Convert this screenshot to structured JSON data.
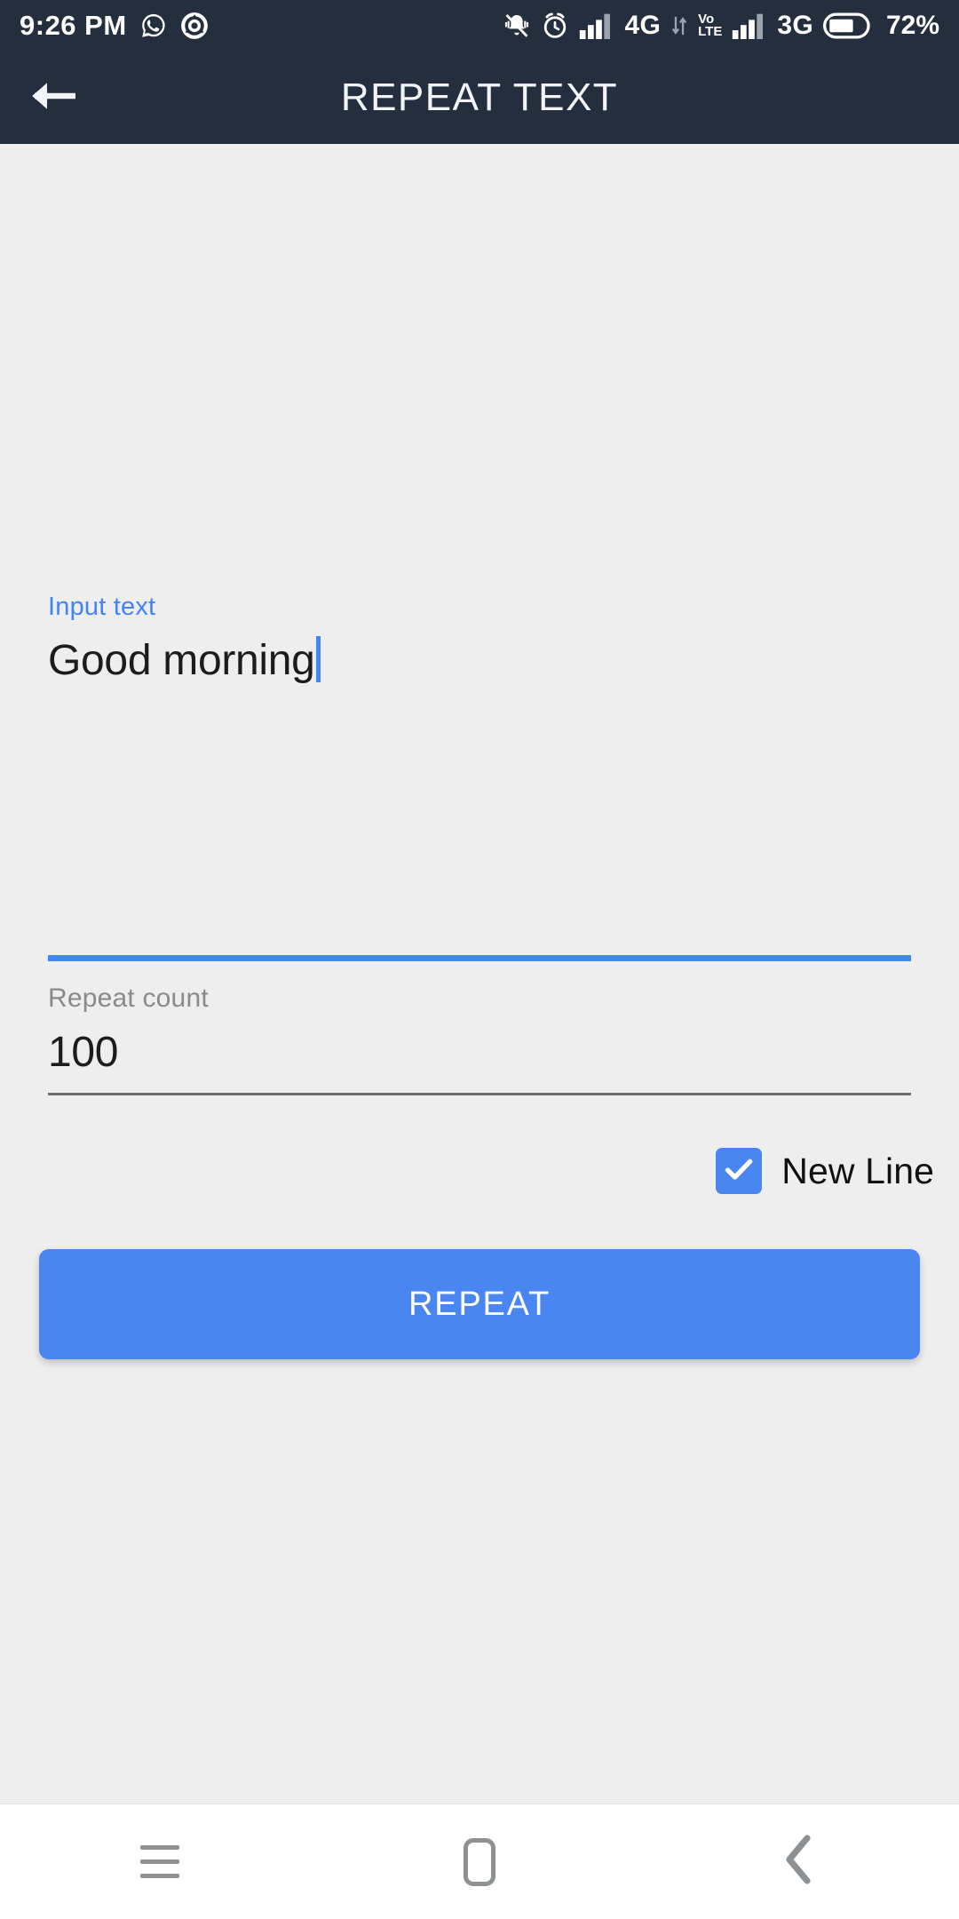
{
  "status_bar": {
    "clock": "9:26 PM",
    "left_icons": [
      "whatsapp-icon",
      "app-circle-icon"
    ],
    "right_icons": [
      "bell-off-icon",
      "alarm-icon",
      "signal-bars-icon",
      "volte-icon",
      "signal-bars-icon",
      "battery-icon"
    ],
    "network_1": "4G",
    "network_2": "3G",
    "volte_top": "Vo",
    "volte_bottom": "LTE",
    "battery_percent": "72%",
    "background_color": "#232f3e"
  },
  "app_bar": {
    "title": "REPEAT TEXT",
    "back_icon": "arrow-left-icon",
    "background_color": "#232f3e",
    "title_color": "#f2f4f7"
  },
  "form": {
    "input_text": {
      "label": "Input text",
      "value": "Good morning",
      "placeholder": "Input text",
      "focused": true,
      "label_color": "#4285f4",
      "underline_color": "#4285f4"
    },
    "repeat_count": {
      "label": "Repeat count",
      "value": "100",
      "placeholder": "Repeat count",
      "focused": false,
      "label_color": "#8a8a8a",
      "underline_color": "#6e6e6e"
    },
    "new_line_checkbox": {
      "label": "New Line",
      "checked": true,
      "accent_color": "#4a86f0"
    },
    "repeat_button": {
      "label": "REPEAT",
      "background_color": "#4a86f0",
      "text_color": "#ffffff"
    }
  },
  "nav_bar": {
    "buttons": [
      {
        "name": "recents",
        "icon": "hamburger-icon"
      },
      {
        "name": "home",
        "icon": "rounded-square-icon"
      },
      {
        "name": "back",
        "icon": "chevron-left-icon"
      }
    ],
    "background_color": "#ffffff"
  },
  "page": {
    "background_color": "#eeeeee"
  }
}
